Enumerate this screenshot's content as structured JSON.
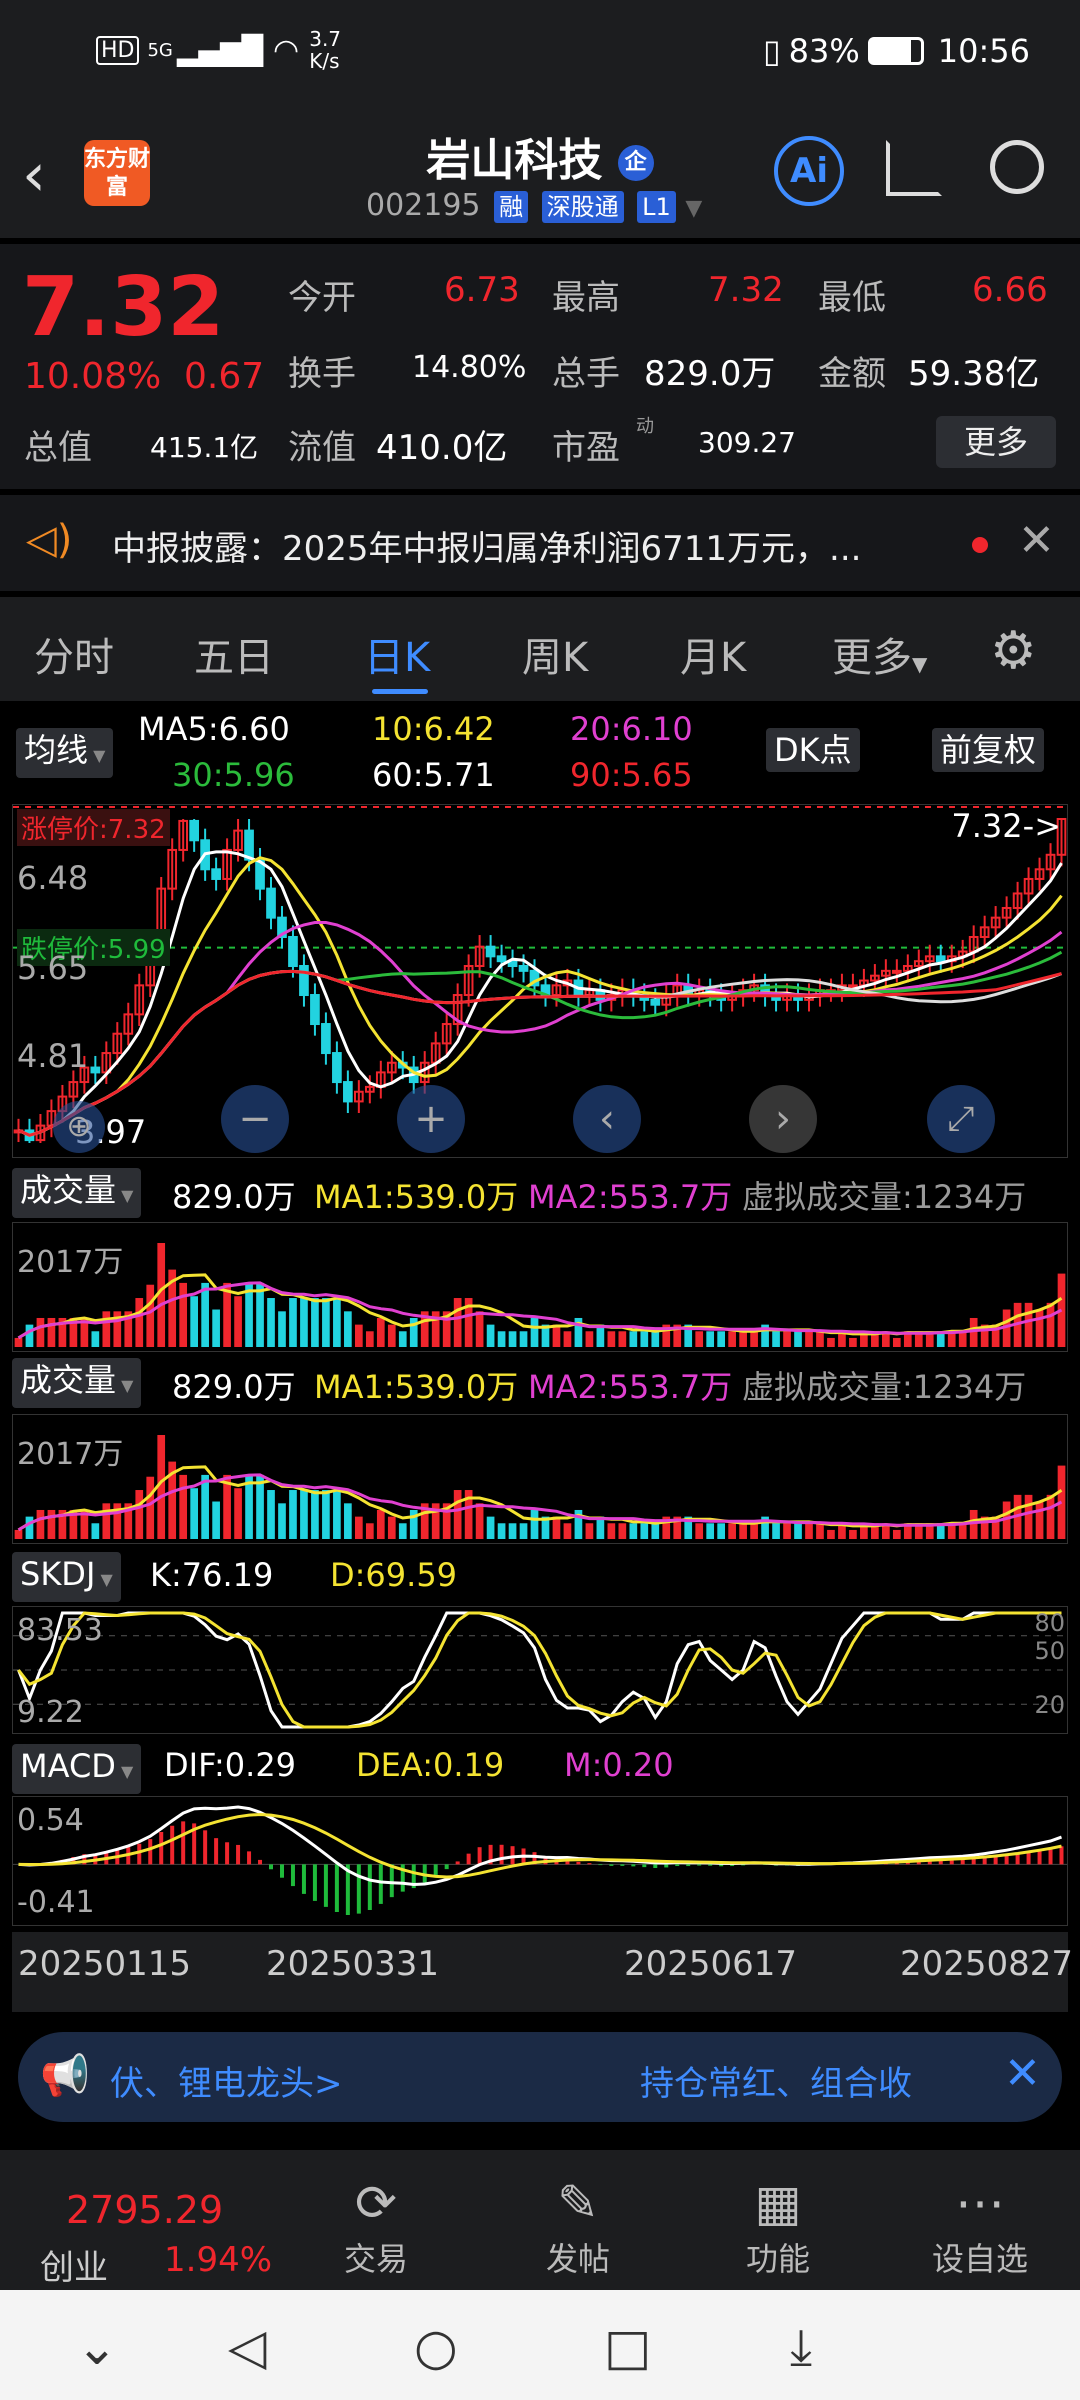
{
  "status": {
    "hd": "HD",
    "net": "5G",
    "speed": "3.7 K/s",
    "battery": "83%",
    "time": "10:56"
  },
  "header": {
    "logo": "东方财富",
    "title": "岩山科技",
    "title_badge": "企",
    "code": "002195",
    "tags": [
      "融",
      "深股通",
      "L1"
    ],
    "ai": "Ai"
  },
  "quote": {
    "price": "7.32",
    "pct": "10.08%",
    "chg": "0.67",
    "open_label": "今开",
    "open": "6.73",
    "high_label": "最高",
    "high": "7.32",
    "low_label": "最低",
    "low": "6.66",
    "turnover_label": "换手",
    "turnover": "14.80%",
    "vol_label": "总手",
    "vol": "829.0万",
    "amount_label": "金额",
    "amount": "59.38亿",
    "mcap_label": "总值",
    "mcap": "415.1亿",
    "float_label": "流值",
    "float": "410.0亿",
    "pe_label": "市盈",
    "pe_sup": "动",
    "pe": "309.27",
    "more": "更多"
  },
  "news": {
    "text": "中报披露：2025年中报归属净利润6711万元，..."
  },
  "tabs": [
    "分时",
    "五日",
    "日K",
    "周K",
    "月K",
    "更多"
  ],
  "main_chart": {
    "ma_label": "均线",
    "ma5": "MA5:6.60",
    "ma10": "10:6.42",
    "ma20": "20:6.10",
    "ma30": "30:5.96",
    "ma60": "60:5.71",
    "ma90": "90:5.65",
    "dk": "DK点",
    "fq": "前复权",
    "limit_up": "涨停价:7.32",
    "limit_down": "跌停价:5.99",
    "y_ticks": [
      "6.48",
      "5.65",
      "4.81"
    ],
    "y_top": "7.32",
    "last": "7.32->",
    "low_mark": "3.97"
  },
  "volume": {
    "label": "成交量",
    "value": "829.0万",
    "ma1": "MA1:539.0万",
    "ma2": "MA2:553.7万",
    "virtual": "虚拟成交量:1234万",
    "y_max": "2017万"
  },
  "skdj": {
    "label": "SKDJ",
    "k": "K:76.19",
    "d": "D:69.59",
    "y_top": "83.53",
    "y_bot": "9.22",
    "r80": "80",
    "r50": "50",
    "r20": "20"
  },
  "macd": {
    "label": "MACD",
    "dif": "DIF:0.29",
    "dea": "DEA:0.19",
    "m": "M:0.20",
    "y_top": "0.54",
    "y_bot": "-0.41"
  },
  "dates": [
    "20250115",
    "20250331",
    "20250617",
    "20250827"
  ],
  "banner": {
    "left": "伏、锂电龙头>",
    "right": "持仓常红、组合收"
  },
  "bottom": {
    "index_value": "2795.29",
    "index_name": "创业",
    "index_pct": "1.94%",
    "items": [
      "交易",
      "发帖",
      "功能",
      "设自选"
    ]
  },
  "chart_data": {
    "type": "candlestick",
    "x_start": "20250115",
    "x_end": "20250827",
    "x_ticks": [
      "20250115",
      "20250331",
      "20250617",
      "20250827"
    ],
    "y_ticks": [
      4.81,
      5.65,
      6.48
    ],
    "y_range": [
      3.97,
      7.32
    ],
    "last_close": 7.32,
    "closes": [
      4.1,
      4.0,
      4.15,
      4.3,
      4.45,
      4.6,
      4.75,
      4.7,
      4.9,
      5.1,
      5.3,
      5.6,
      6.0,
      6.6,
      7.0,
      7.3,
      7.1,
      6.8,
      6.7,
      7.0,
      7.2,
      6.9,
      6.6,
      6.3,
      6.1,
      5.8,
      5.5,
      5.2,
      4.9,
      4.6,
      4.4,
      4.5,
      4.55,
      4.7,
      4.8,
      4.75,
      4.6,
      4.8,
      5.0,
      5.2,
      5.5,
      5.8,
      6.0,
      5.9,
      5.85,
      5.8,
      5.75,
      5.6,
      5.5,
      5.6,
      5.65,
      5.5,
      5.55,
      5.45,
      5.5,
      5.55,
      5.5,
      5.45,
      5.4,
      5.5,
      5.6,
      5.5,
      5.55,
      5.5,
      5.45,
      5.5,
      5.55,
      5.6,
      5.5,
      5.45,
      5.5,
      5.45,
      5.5,
      5.55,
      5.55,
      5.6,
      5.6,
      5.65,
      5.7,
      5.75,
      5.75,
      5.8,
      5.85,
      5.9,
      5.85,
      5.9,
      5.95,
      6.1,
      6.2,
      6.3,
      6.4,
      6.55,
      6.7,
      6.8,
      6.95,
      7.32
    ],
    "volume_max": "2017万"
  }
}
